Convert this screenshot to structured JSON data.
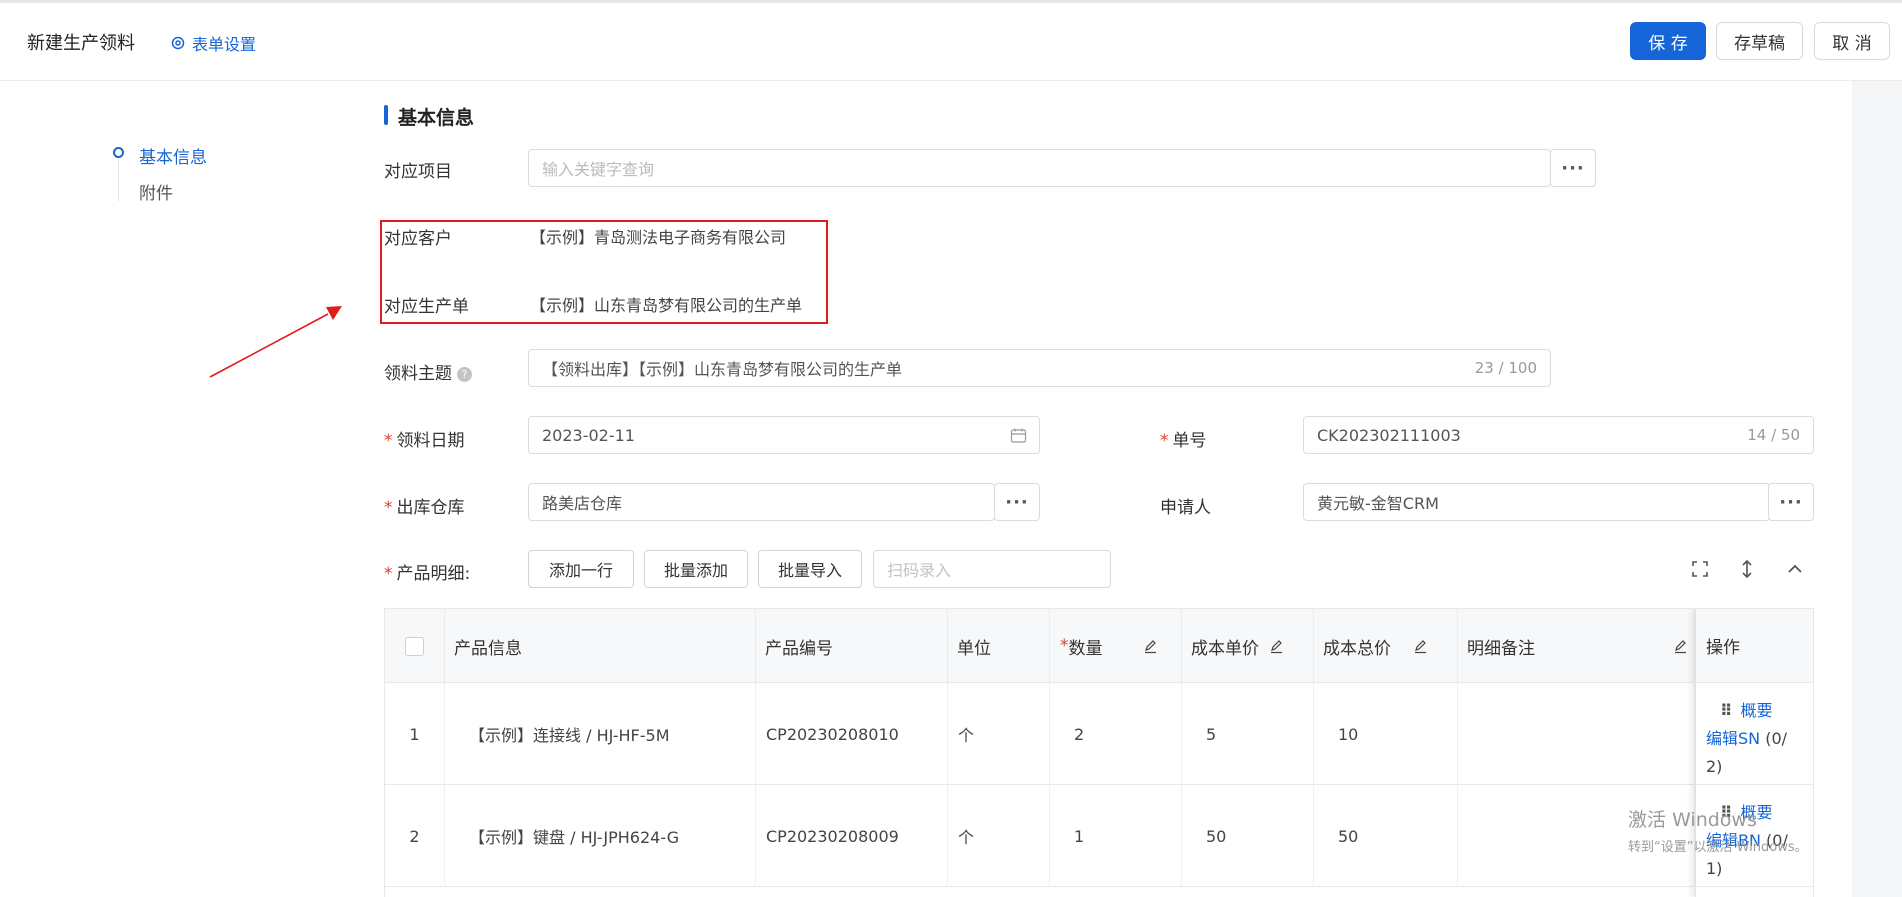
{
  "header": {
    "title": "新建生产领料",
    "form_settings": "表单设置",
    "save": "保 存",
    "draft": "存草稿",
    "cancel": "取 消"
  },
  "anchor_nav": {
    "items": [
      "基本信息",
      "附件"
    ]
  },
  "section": {
    "title": "基本信息"
  },
  "form": {
    "project": {
      "label": "对应项目",
      "placeholder": "输入关键字查询"
    },
    "customer": {
      "label": "对应客户",
      "value": "【示例】青岛测法电子商务有限公司"
    },
    "production_order": {
      "label": "对应生产单",
      "value": "【示例】山东青岛梦有限公司的生产单"
    },
    "subject": {
      "label": "领料主题",
      "value": "【领料出库】【示例】山东青岛梦有限公司的生产单",
      "counter": "23 / 100"
    },
    "date": {
      "label": "领料日期",
      "value": "2023-02-11"
    },
    "order_no": {
      "label": "单号",
      "value": "CK202302111003",
      "counter": "14 / 50"
    },
    "warehouse": {
      "label": "出库仓库",
      "value": "路美店仓库"
    },
    "applicant": {
      "label": "申请人",
      "value": "黄元敏-金智CRM"
    },
    "product_details": {
      "label": "产品明细:"
    },
    "more_glyph": "···"
  },
  "product_toolbar": {
    "add_row": "添加一行",
    "batch_add": "批量添加",
    "batch_import": "批量导入",
    "scan_placeholder": "扫码录入"
  },
  "table": {
    "columns": [
      "产品信息",
      "产品编号",
      "单位",
      "数量",
      "成本单价",
      "成本总价",
      "明细备注",
      "操作"
    ],
    "rows": [
      {
        "index": "1",
        "product": "【示例】连接线 / HJ-HF-5M",
        "code": "CP20230208010",
        "unit": "个",
        "qty": "2",
        "unit_cost": "5",
        "total_cost": "10",
        "note": "",
        "op_summary": "概要",
        "op_edit": "编辑SN",
        "op_count_a": "(0/",
        "op_count_b": "2)"
      },
      {
        "index": "2",
        "product": "【示例】键盘 / HJ-JPH624-G",
        "code": "CP20230208009",
        "unit": "个",
        "qty": "1",
        "unit_cost": "50",
        "total_cost": "50",
        "note": "",
        "op_summary": "概要",
        "op_edit": "编辑BN",
        "op_count_a": "(0/",
        "op_count_b": "1)"
      }
    ]
  },
  "watermark": {
    "line1": "激活 Windows",
    "line2": "转到“设置”以激活 Windows。"
  },
  "colors": {
    "primary": "#1565d8",
    "required": "#e53935",
    "annotation": "#e21b1b"
  }
}
